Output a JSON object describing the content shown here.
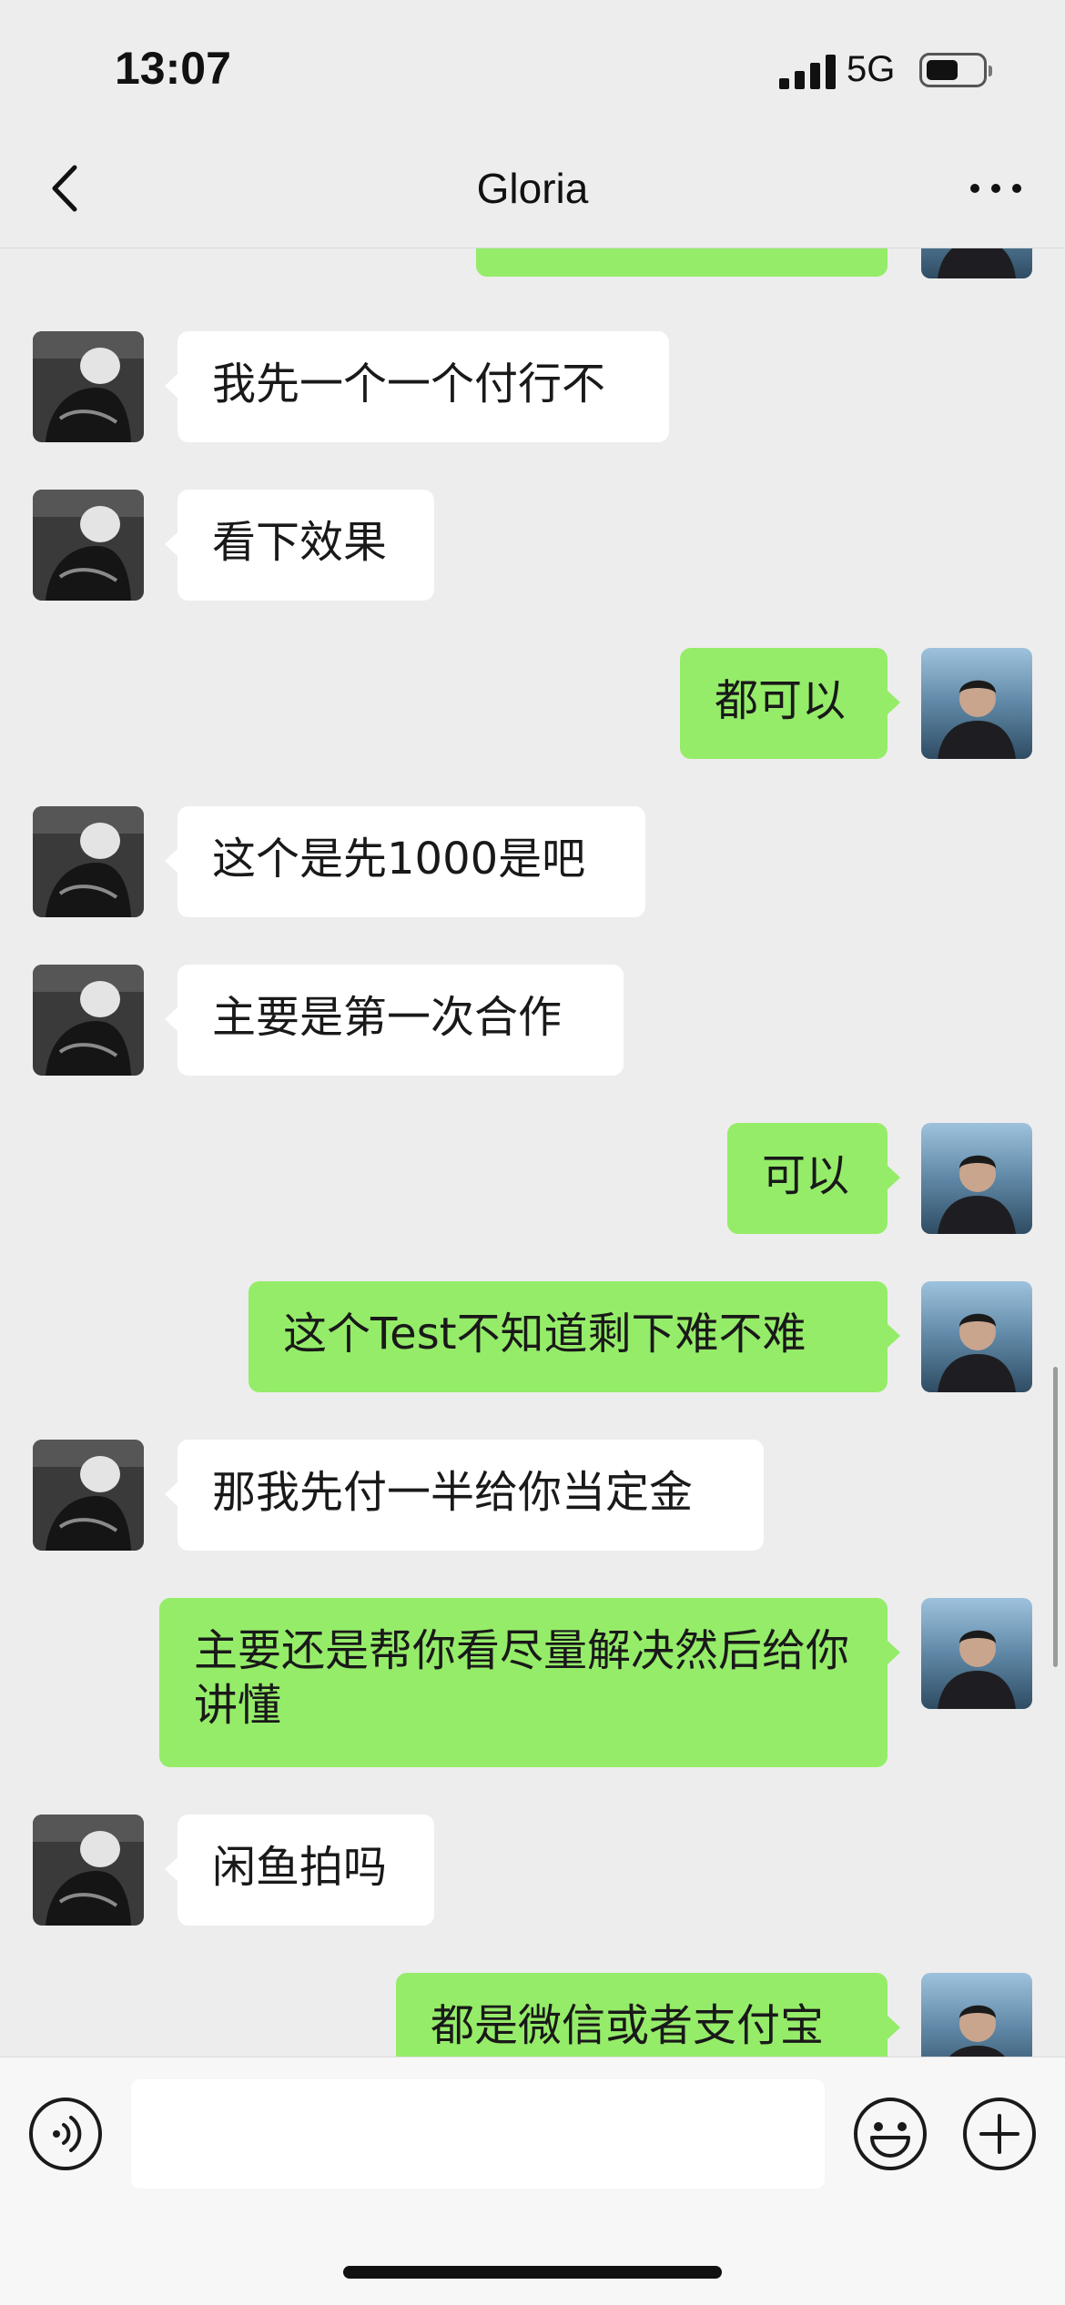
{
  "status_bar": {
    "time": "13:07",
    "network": "5G",
    "signal_icon": "signal-bars-icon",
    "battery_icon": "battery-icon"
  },
  "nav": {
    "title": "Gloria",
    "back_icon": "chevron-left-icon",
    "more_icon": "more-dots-icon"
  },
  "messages": [
    {
      "side": "in",
      "text": "我先一个一个付行不"
    },
    {
      "side": "in",
      "text": "看下效果"
    },
    {
      "side": "out",
      "text": "都可以"
    },
    {
      "side": "in",
      "text": "这个是先1000是吧"
    },
    {
      "side": "in",
      "text": "主要是第一次合作"
    },
    {
      "side": "out",
      "text": "可以"
    },
    {
      "side": "out",
      "text": "这个Test不知道剩下难不难"
    },
    {
      "side": "in",
      "text": "那我先付一半给你当定金"
    },
    {
      "side": "out",
      "text": "主要还是帮你看尽量解决然后给你讲懂"
    },
    {
      "side": "in",
      "text": "闲鱼拍吗"
    },
    {
      "side": "out",
      "text": "都是微信或者支付宝"
    }
  ],
  "input_bar": {
    "voice_icon": "voice-icon",
    "emoji_icon": "emoji-icon",
    "plus_icon": "plus-icon",
    "input_value": ""
  },
  "colors": {
    "background": "#ededed",
    "outgoing_bubble": "#95ec69",
    "incoming_bubble": "#ffffff"
  }
}
